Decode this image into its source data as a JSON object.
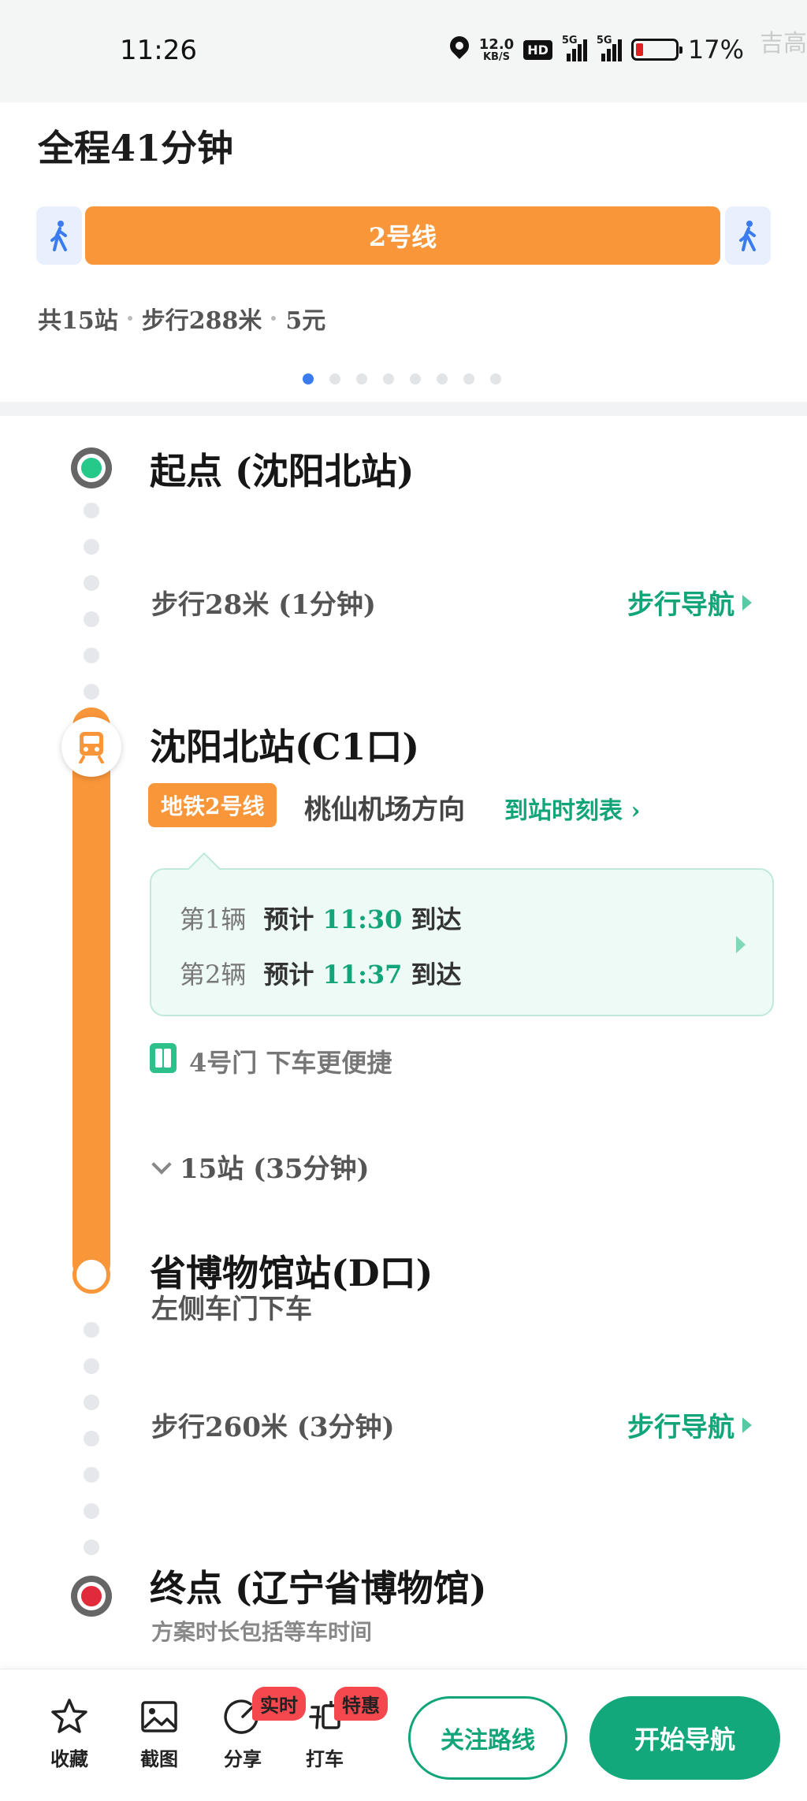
{
  "status_bar": {
    "time": "11:26",
    "speed_value": "12.0",
    "speed_unit": "KB/S",
    "hd": "HD",
    "net1": "5G",
    "net2": "5G",
    "battery_pct": "17%",
    "battery_level": 0.17,
    "watermark": "吉高"
  },
  "summary": {
    "total_time": "全程41分钟",
    "line_name": "2号线",
    "stations": "共15站",
    "walk": "步行288米",
    "fare": "5元",
    "page_count": 8,
    "page_active": 1,
    "line_color": "#fa963a"
  },
  "timeline": {
    "start_title": "起点 (沈阳北站)",
    "walk1_text": "步行28米 (1分钟)",
    "walk1_nav": "步行导航",
    "board_station": "沈阳北站(C1口)",
    "line_badge": "地铁2号线",
    "direction": "桃仙机场方向",
    "timetable_link": "到站时刻表 ›",
    "arrivals": [
      {
        "no": "第1辆",
        "pre": "预计",
        "time": "11:30",
        "suffix": "到达"
      },
      {
        "no": "第2辆",
        "pre": "预计",
        "time": "11:37",
        "suffix": "到达"
      }
    ],
    "door_tip": "4号门 下车更便捷",
    "stops_summary": "15站 (35分钟)",
    "alight_station": "省博物馆站(D口)",
    "alight_side": "左侧车门下车",
    "walk2_text": "步行260米 (3分钟)",
    "walk2_nav": "步行导航",
    "end_title": "终点 (辽宁省博物馆)",
    "end_note": "方案时长包括等车时间"
  },
  "bottom_bar": {
    "collect": "收藏",
    "screenshot": "截图",
    "share": "分享",
    "share_tag": "实时",
    "taxi": "打车",
    "taxi_tag": "特惠",
    "follow_route": "关注路线",
    "start_nav": "开始导航",
    "accent": "#13a87b"
  }
}
